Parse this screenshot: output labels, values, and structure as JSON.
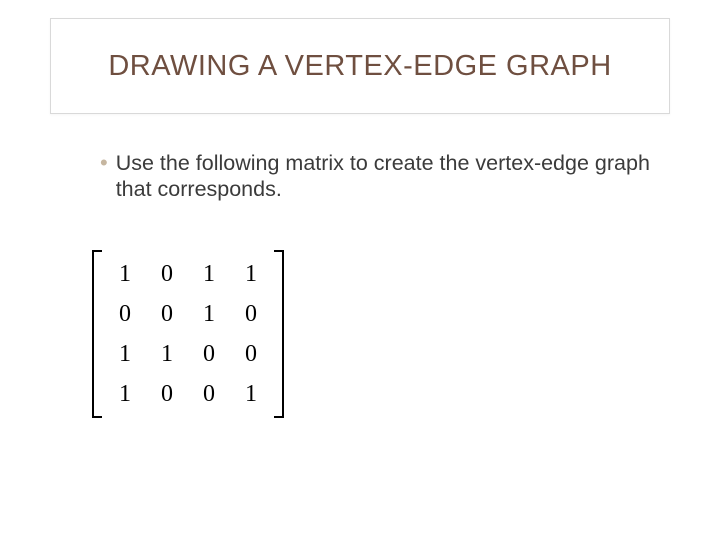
{
  "title": "DRAWING A VERTEX-EDGE GRAPH",
  "bullet": "Use the following matrix to create the vertex-edge graph that corresponds.",
  "matrix": {
    "rows": [
      [
        "1",
        "0",
        "1",
        "1"
      ],
      [
        "0",
        "0",
        "1",
        "0"
      ],
      [
        "1",
        "1",
        "0",
        "0"
      ],
      [
        "1",
        "0",
        "0",
        "1"
      ]
    ]
  }
}
